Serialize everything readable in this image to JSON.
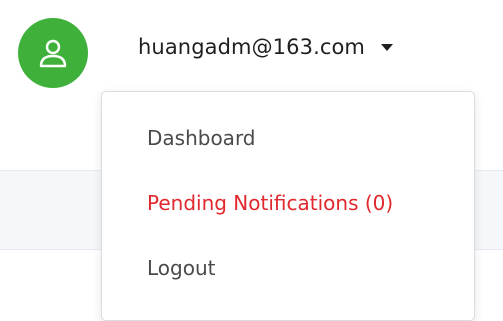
{
  "header": {
    "avatar_icon": "user-icon",
    "avatar_color": "#3fb13a",
    "user_email": "huangadm@163.com",
    "caret_icon": "caret-down-icon"
  },
  "dropdown": {
    "items": [
      {
        "label": "Dashboard",
        "color": "#4a4a4a"
      },
      {
        "label": "Pending Notifications (0)",
        "color": "#e0282e"
      },
      {
        "label": "Logout",
        "color": "#4a4a4a"
      }
    ]
  }
}
